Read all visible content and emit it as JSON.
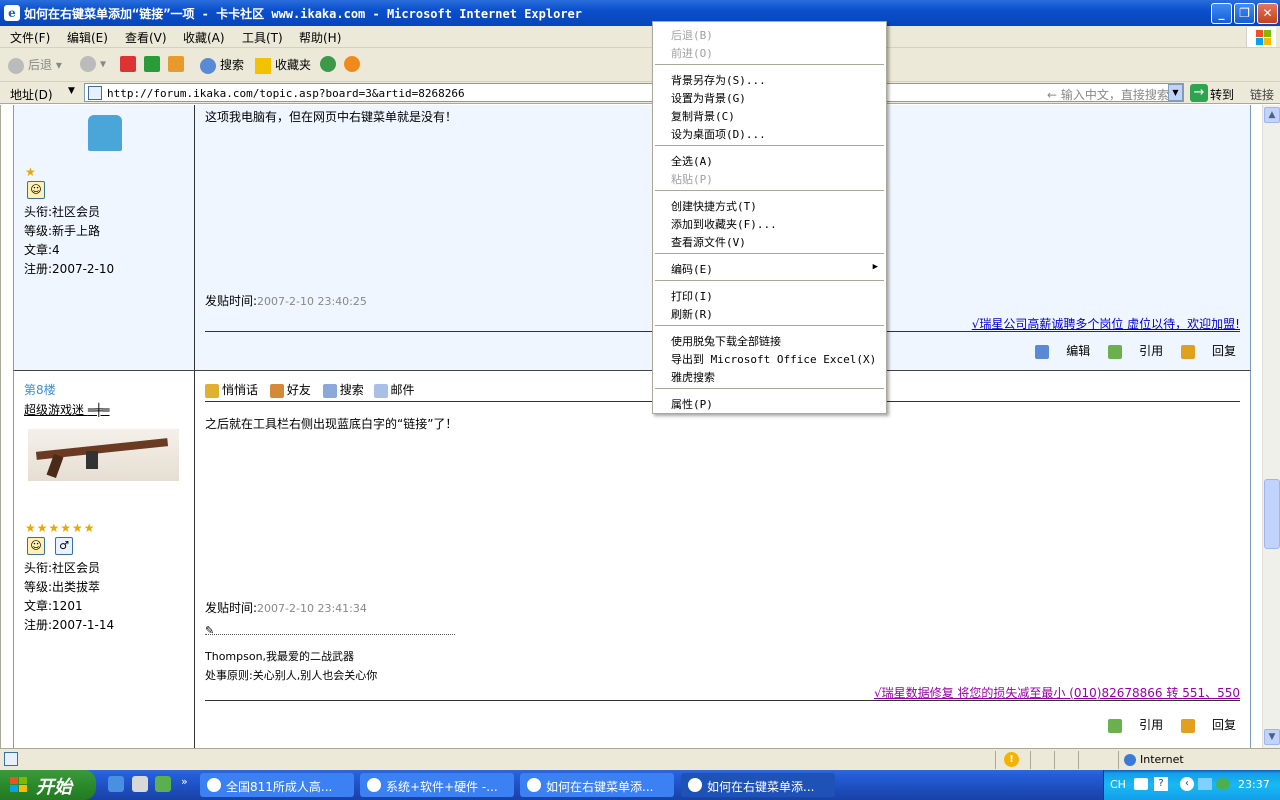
{
  "window": {
    "title": "如何在右键菜单添加“链接”一项 - 卡卡社区 www.ikaka.com - Microsoft Internet Explorer",
    "buttons": {
      "minimize": "_",
      "restore": "❐",
      "close": "✕"
    }
  },
  "menu": [
    "文件(F)",
    "编辑(E)",
    "查看(V)",
    "收藏(A)",
    "工具(T)",
    "帮助(H)"
  ],
  "toolbar": {
    "back": "后退",
    "search": "搜索",
    "favorites": "收藏夹"
  },
  "address": {
    "label": "地址(D)",
    "url": "http://forum.ikaka.com/topic.asp?board=3&artid=8268266",
    "search_placeholder": "输入中文，直接搜索",
    "go": "转到",
    "links": "链接"
  },
  "posts": [
    {
      "floor": "",
      "text": "这项我电脑有，但在网页中右键菜单就是没有！",
      "user": {
        "title": "头衔:社区会员",
        "level": "等级:新手上路",
        "posts": "文章:4",
        "registered": "注册:2007-2-10"
      },
      "time_label": "发贴时间:",
      "time": "2007-2-10 23:40:25",
      "ad": "√瑞星公司高薪诚聘多个岗位 虚位以待，欢迎加盟!",
      "ad_color": "#0000cc",
      "actions": [
        "编辑",
        "引用",
        "回复"
      ]
    },
    {
      "floor": "第8楼",
      "username": "超级游戏迷",
      "toolbar": [
        "悄悄话",
        "好友",
        "搜索",
        "邮件"
      ],
      "text": "之后就在工具栏右侧出现蓝底白字的“链接”了！",
      "user": {
        "title": "头衔:社区会员",
        "level": "等级:出类拔萃",
        "posts": "文章:1201",
        "registered": "注册:2007-1-14"
      },
      "time_label": "发贴时间:",
      "time": "2007-2-10 23:41:34",
      "signature": [
        "Thompson,我最爱的二战武器",
        "处事原则:关心别人,别人也会关心你"
      ],
      "ad": "√瑞星数据修复 将您的损失减至最小 (010)82678866 转 551、550",
      "ad_color": "#9900aa",
      "actions": [
        "引用",
        "回复"
      ]
    }
  ],
  "context_menu": {
    "items": [
      {
        "label": "后退(B)",
        "disabled": true
      },
      {
        "label": "前进(O)",
        "disabled": true
      },
      {
        "label": "背景另存为(S)...",
        "disabled": false
      },
      {
        "label": "设置为背景(G)",
        "disabled": false
      },
      {
        "label": "复制背景(C)",
        "disabled": false
      },
      {
        "label": "设为桌面项(D)...",
        "disabled": false
      },
      {
        "label": "全选(A)",
        "disabled": false
      },
      {
        "label": "粘贴(P)",
        "disabled": true
      },
      {
        "label": "创建快捷方式(T)",
        "disabled": false
      },
      {
        "label": "添加到收藏夹(F)...",
        "disabled": false
      },
      {
        "label": "查看源文件(V)",
        "disabled": false
      },
      {
        "label": "编码(E)",
        "disabled": false,
        "submenu": true
      },
      {
        "label": "打印(I)",
        "disabled": false
      },
      {
        "label": "刷新(R)",
        "disabled": false
      },
      {
        "label": "使用脱兔下载全部链接",
        "disabled": false
      },
      {
        "label": "导出到 Microsoft Office Excel(X)",
        "disabled": false
      },
      {
        "label": "雅虎搜索",
        "disabled": false
      },
      {
        "label": "属性(P)",
        "disabled": false
      }
    ]
  },
  "status": {
    "zone": "Internet"
  },
  "taskbar": {
    "start": "开始",
    "tasks": [
      "全国811所成人高...",
      "系统+软件+硬件 -...",
      "如何在右键菜单添...",
      "如何在右键菜单添..."
    ],
    "lang": "CH",
    "clock": "23:37"
  }
}
